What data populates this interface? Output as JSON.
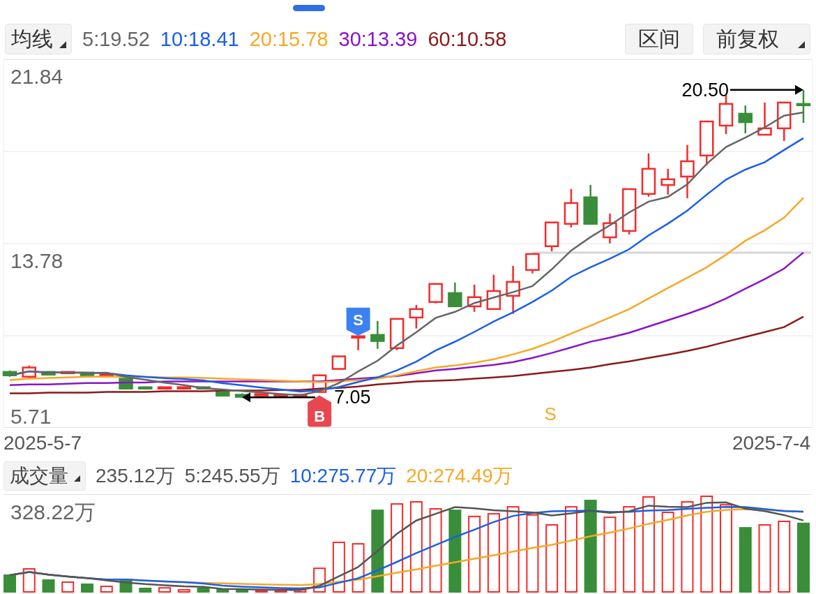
{
  "header": {
    "indicator": "均线",
    "ma_legend": [
      {
        "label": "5:19.52",
        "color": "#666666"
      },
      {
        "label": "10:18.41",
        "color": "#1b5fe8"
      },
      {
        "label": "20:15.78",
        "color": "#f7a825"
      },
      {
        "label": "30:13.39",
        "color": "#8a14c8"
      },
      {
        "label": "60:10.58",
        "color": "#8b1a1a"
      }
    ],
    "buttons": [
      {
        "label": "区间",
        "kind": "plain"
      },
      {
        "label": "前复权",
        "kind": "dropdown"
      }
    ]
  },
  "price_panel": {
    "axis_labels": [
      "21.84",
      "13.78",
      "5.71"
    ],
    "price_labels": [
      {
        "kind": "high",
        "text": "20.50"
      },
      {
        "kind": "low",
        "text": "7.05"
      }
    ],
    "markers": [
      {
        "kind": "buy",
        "label": "B"
      },
      {
        "kind": "sell",
        "label": "S"
      },
      {
        "kind": "hint",
        "label": "S"
      }
    ],
    "dates": [
      "2025-5-7",
      "2025-7-4"
    ]
  },
  "volume_panel": {
    "indicator": "成交量",
    "legend": [
      {
        "label": "235.12万",
        "color": "#555555"
      },
      {
        "label": "5:245.55万",
        "color": "#555555"
      },
      {
        "label": "10:275.77万",
        "color": "#1b5fe8"
      },
      {
        "label": "20:274.49万",
        "color": "#f7a825"
      }
    ],
    "axis_label": "328.22万"
  }
}
